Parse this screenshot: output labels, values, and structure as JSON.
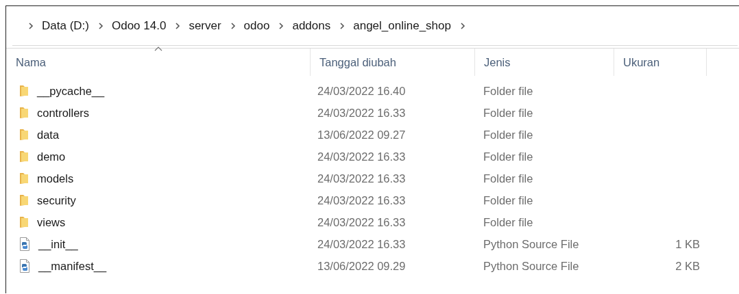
{
  "breadcrumb": [
    "Data (D:)",
    "Odoo 14.0",
    "server",
    "odoo",
    "addons",
    "angel_online_shop"
  ],
  "table": {
    "columns": [
      {
        "label": "Nama",
        "sorted": true
      },
      {
        "label": "Tanggal diubah",
        "sorted": false
      },
      {
        "label": "Jenis",
        "sorted": false
      },
      {
        "label": "Ukuran",
        "sorted": false
      }
    ],
    "rows": [
      {
        "kind": "folder",
        "name": "__pycache__",
        "date": "24/03/2022 16.40",
        "type": "Folder file"
      },
      {
        "kind": "folder",
        "name": "controllers",
        "date": "24/03/2022 16.33",
        "type": "Folder file"
      },
      {
        "kind": "folder",
        "name": "data",
        "date": "13/06/2022 09.27",
        "type": "Folder file"
      },
      {
        "kind": "folder",
        "name": "demo",
        "date": "24/03/2022 16.33",
        "type": "Folder file"
      },
      {
        "kind": "folder",
        "name": "models",
        "date": "24/03/2022 16.33",
        "type": "Folder file"
      },
      {
        "kind": "folder",
        "name": "security",
        "date": "24/03/2022 16.33",
        "type": "Folder file"
      },
      {
        "kind": "folder",
        "name": "views",
        "date": "24/03/2022 16.33",
        "type": "Folder file"
      },
      {
        "kind": "python",
        "name": "__init__",
        "date": "24/03/2022 16.33",
        "type": "Python Source File",
        "size": "1 KB"
      },
      {
        "kind": "python",
        "name": "__manifest__",
        "date": "13/06/2022 09.29",
        "type": "Python Source File",
        "size": "2 KB"
      }
    ]
  }
}
